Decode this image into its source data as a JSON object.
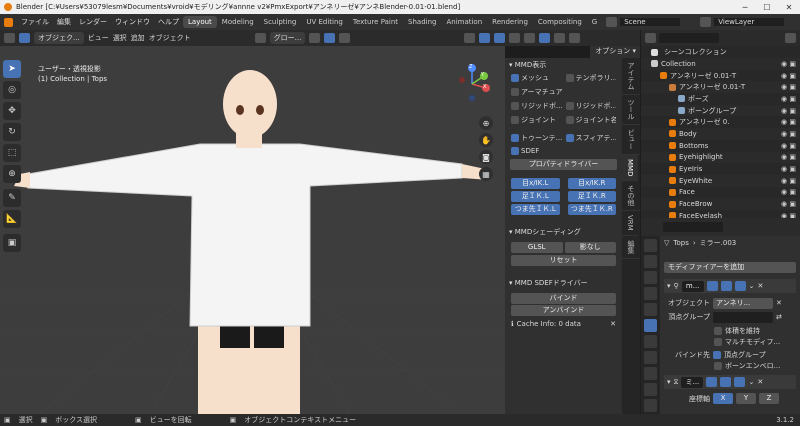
{
  "window": {
    "title": "Blender [C:¥Users¥53079lesm¥Documents¥vroid¥モデリング¥annne v2¥PmxExport¥アンネリーゼ¥アンネBlender-0.01-01.blend]"
  },
  "topbar": {
    "menus": [
      "ファイル",
      "編集",
      "レンダー",
      "ウィンドウ",
      "ヘルプ"
    ],
    "workspaces": [
      "Layout",
      "Modeling",
      "Sculpting",
      "UV Editing",
      "Texture Paint",
      "Shading",
      "Animation",
      "Rendering",
      "Compositing",
      "G"
    ],
    "scene": "Scene",
    "view_layer": "ViewLayer"
  },
  "viewport_header": {
    "mode": "オブジェク...",
    "menus": [
      "ビュー",
      "選択",
      "追加",
      "オブジェクト"
    ],
    "transform": "グロー...",
    "options": "オプション ▾"
  },
  "viewport": {
    "view_name": "ユーザー・透視投影",
    "collection": "(1) Collection | Tops"
  },
  "gizmo": {
    "x": "X",
    "y": "Y",
    "z": "Z"
  },
  "mmd_display": {
    "title": "MMD表示",
    "items": [
      {
        "label": "メッシュ",
        "on": true
      },
      {
        "label": "テンポラリ...",
        "on": false
      },
      {
        "label": "アーマチュア",
        "on": false
      },
      {
        "label": "",
        "on": false
      },
      {
        "label": "リジッドボ...",
        "on": false
      },
      {
        "label": "リジッドボ...",
        "on": false
      },
      {
        "label": "ジョイント",
        "on": false
      },
      {
        "label": "ジョイント名",
        "on": false
      },
      {
        "label": "トゥーンテ...",
        "on": true
      },
      {
        "label": "スフィアテ...",
        "on": true
      },
      {
        "label": "SDEF",
        "on": true
      }
    ],
    "prop_driver": "プロパティドライバー",
    "ik_buttons": [
      "目x/IK.L",
      "目x/IK.R",
      "足ＩＫ.L",
      "足ＩＫ.R",
      "つま先ＩＫ.L",
      "つま先ＩＫ.R"
    ]
  },
  "mmd_shading": {
    "title": "MMDシェーディング",
    "glsl": "GLSL",
    "shadeless": "影なし",
    "reset": "リセット"
  },
  "mmd_sdef": {
    "title": "MMD SDEFドライバー",
    "bind": "バインド",
    "unbind": "アンバインド",
    "cache": "Cache Info: 0 data"
  },
  "vtabs": [
    "アイテム",
    "ツール",
    "ビュー",
    "MMD",
    "その他",
    "VRM",
    "編集"
  ],
  "outliner": {
    "title": "シーンコレクション",
    "rows": [
      {
        "indent": 0,
        "label": "Collection",
        "color": "#cccccc"
      },
      {
        "indent": 1,
        "label": "アンネリーゼ 0.01-T",
        "color": "#e87d0d"
      },
      {
        "indent": 2,
        "label": "アンネリーゼ 0.01-T",
        "color": "#c87d3d"
      },
      {
        "indent": 3,
        "label": "ポーズ",
        "color": "#8aa8c8"
      },
      {
        "indent": 3,
        "label": "ボーングループ",
        "color": "#8aa8c8"
      },
      {
        "indent": 2,
        "label": "アンネリーゼ 0.",
        "color": "#e87d0d"
      },
      {
        "indent": 2,
        "label": "Body",
        "color": "#e87d0d"
      },
      {
        "indent": 2,
        "label": "Bottoms",
        "color": "#e87d0d"
      },
      {
        "indent": 2,
        "label": "Eyehighlight",
        "color": "#e87d0d"
      },
      {
        "indent": 2,
        "label": "EyeIris",
        "color": "#e87d0d"
      },
      {
        "indent": 2,
        "label": "EyeWhite",
        "color": "#e87d0d"
      },
      {
        "indent": 2,
        "label": "Face",
        "color": "#e87d0d"
      },
      {
        "indent": 2,
        "label": "FaceBrow",
        "color": "#e87d0d"
      },
      {
        "indent": 2,
        "label": "FaceEyelash",
        "color": "#e87d0d"
      }
    ]
  },
  "properties": {
    "breadcrumb_obj": "Tops",
    "breadcrumb_mod": "ミラー.003",
    "add_modifier": "モディファイアーを追加",
    "mod1_name": "m...",
    "object_label": "オブジェクト",
    "object_value": "アンネリ...",
    "vgroup_label": "頂点グループ",
    "keep_volume": "体積を維持",
    "multi_modifier": "マルチモディフ...",
    "bind_to_label": "バインド先",
    "bind_vgroup": "頂点グループ",
    "bind_bone": "ボーンエンベロ...",
    "mod2_name": "ミ...",
    "axis_label": "座標軸",
    "axes": [
      "X",
      "Y",
      "Z"
    ]
  },
  "status": {
    "select": "選択",
    "box_select": "ボックス選択",
    "rotate_view": "ビューを回転",
    "context_menu": "オブジェクトコンテキストメニュー",
    "version": "3.1.2"
  }
}
